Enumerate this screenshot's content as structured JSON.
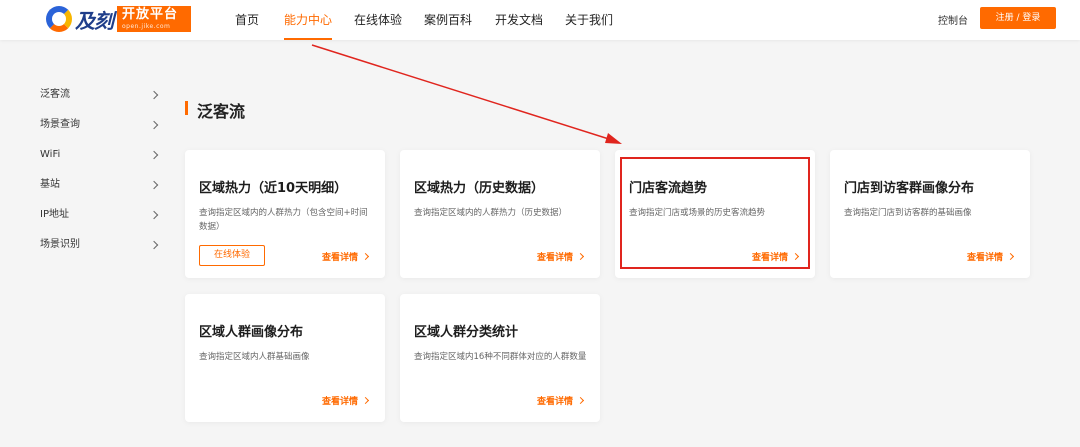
{
  "header": {
    "logo": {
      "name": "及刻",
      "badge_title": "开放平台",
      "badge_sub": "open.jike.com"
    },
    "nav": [
      {
        "label": "首页"
      },
      {
        "label": "能力中心"
      },
      {
        "label": "在线体验"
      },
      {
        "label": "案例百科"
      },
      {
        "label": "开发文档"
      },
      {
        "label": "关于我们"
      }
    ],
    "active_nav": "能力中心",
    "console_label": "控制台",
    "login_label": "注册 / 登录"
  },
  "sidebar": {
    "items": [
      {
        "label": "泛客流"
      },
      {
        "label": "场景查询"
      },
      {
        "label": "WiFi"
      },
      {
        "label": "基站"
      },
      {
        "label": "IP地址"
      },
      {
        "label": "场景识别"
      }
    ]
  },
  "section": {
    "title": "泛客流"
  },
  "cards": [
    {
      "title": "区域热力（近10天明细）",
      "desc": "查询指定区域内的人群热力（包含空间+时间数据）",
      "trial": "在线体验",
      "more": "查看详情"
    },
    {
      "title": "区域热力（历史数据）",
      "desc": "查询指定区域内的人群热力（历史数据）",
      "more": "查看详情"
    },
    {
      "title": "门店客流趋势",
      "desc": "查询指定门店或场景的历史客流趋势",
      "more": "查看详情"
    },
    {
      "title": "门店到访客群画像分布",
      "desc": "查询指定门店到访客群的基础画像",
      "more": "查看详情"
    },
    {
      "title": "区域人群画像分布",
      "desc": "查询指定区域内人群基础画像",
      "more": "查看详情"
    },
    {
      "title": "区域人群分类统计",
      "desc": "查询指定区域内16种不同群体对应的人群数量",
      "more": "查看详情"
    }
  ],
  "colors": {
    "accent": "#ff6a00",
    "annotation": "#e0251e",
    "background": "#f5f5f5"
  }
}
